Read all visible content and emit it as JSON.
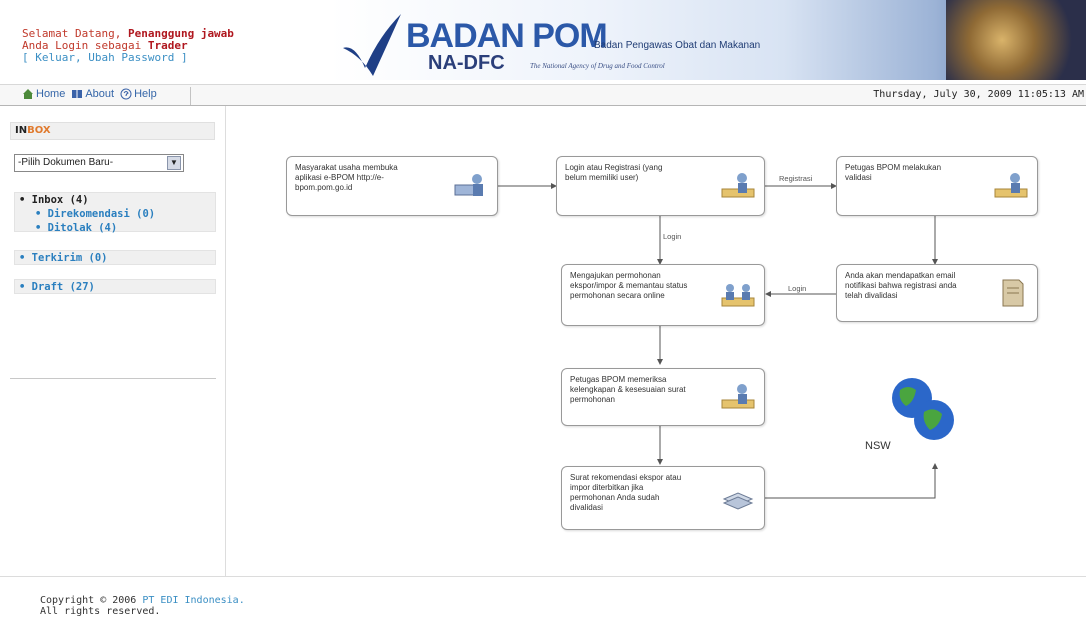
{
  "header": {
    "welcome_prefix": "Selamat Datang, ",
    "welcome_name": "Penanggung jawab",
    "login_prefix": "Anda Login sebagai ",
    "login_role": "Trader",
    "account_links": "[ Keluar, Ubah Password ]",
    "brand": "BADAN POM",
    "brand_sub": "Badan Pengawas Obat dan Makanan",
    "brand_short": "NA-DFC",
    "brand_tagline": "The National Agency of Drug and Food Control"
  },
  "nav": {
    "home": "Home",
    "about": "About",
    "help": "Help",
    "datetime": "Thursday, July 30, 2009 11:05:13 AM"
  },
  "sidebar": {
    "inbox_title_a": "IN",
    "inbox_title_b": "BOX",
    "new_doc_select": "-Pilih Dokumen Baru-",
    "inbox_label": "• Inbox (4)",
    "inbox_items": [
      "• Direkomendasi (0)",
      "• Ditolak (4)"
    ],
    "sent_label": "• Terkirim (0)",
    "draft_label": "• Draft (27)"
  },
  "flow": {
    "node1": "Masyarakat usaha membuka aplikasi e-BPOM http://e-bpom.pom.go.id",
    "node2": "Login atau Registrasi (yang belum memiliki user)",
    "node3": "Petugas BPOM melakukan validasi",
    "node4": "Mengajukan permohonan ekspor/impor & memantau status permohonan secara online",
    "node5": "Anda akan mendapatkan email notifikasi bahwa registrasi anda telah divalidasi",
    "node6": "Petugas BPOM memeriksa kelengkapan & kesesuaian surat permohonan",
    "node7": "Surat rekomendasi ekspor atau impor diterbitkan jika permohonan Anda sudah divalidasi",
    "label_registrasi": "Registrasi",
    "label_login_down": "Login",
    "label_login_left": "Login",
    "nsw": "NSW"
  },
  "footer": {
    "copyright_prefix": "Copyright © 2006 ",
    "company": "PT EDI Indonesia.",
    "rights": "All rights reserved."
  }
}
